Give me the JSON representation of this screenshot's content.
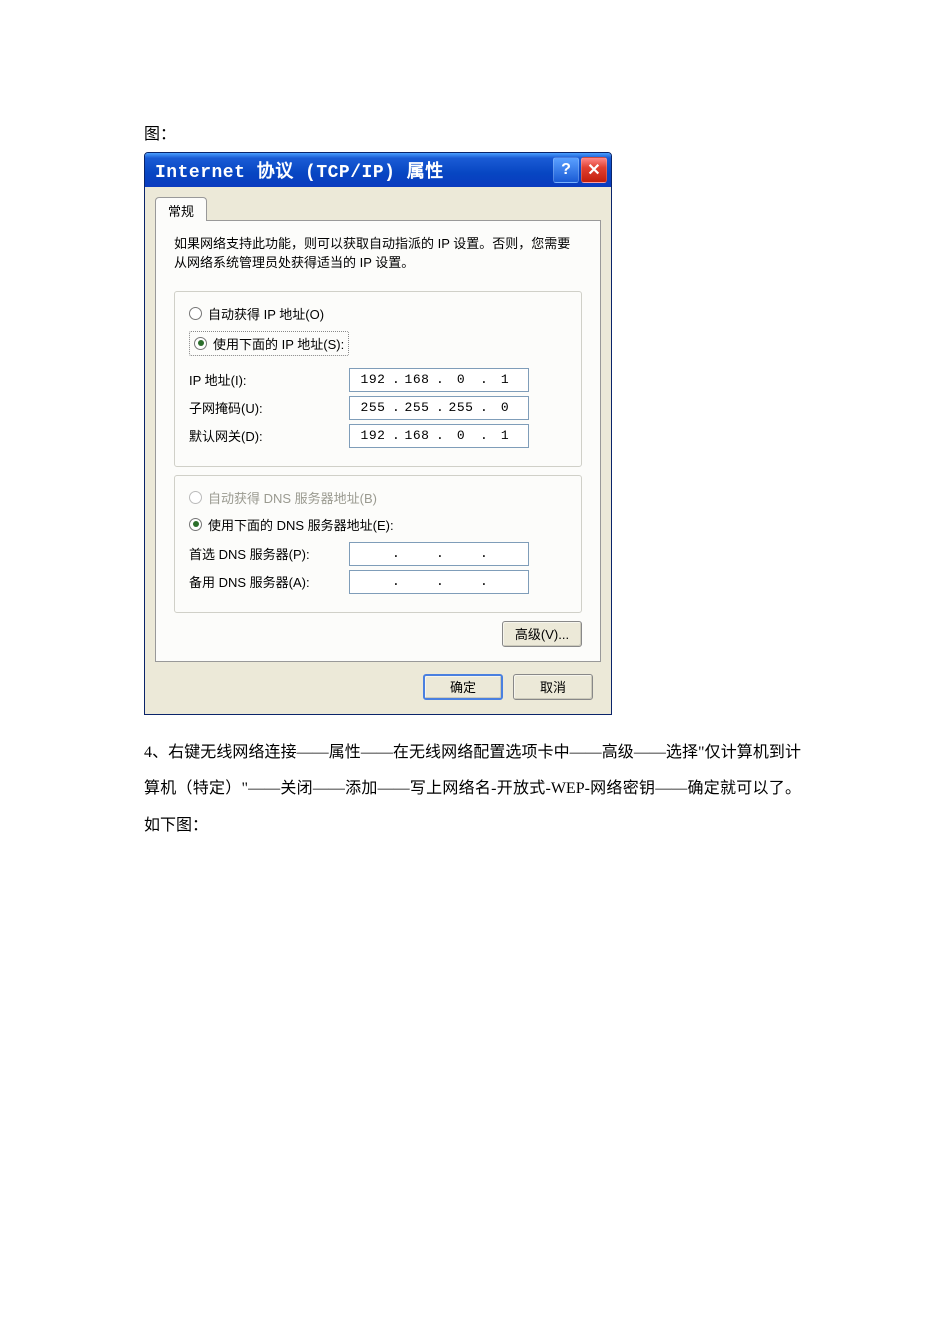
{
  "doc": {
    "intro": "图：",
    "para4": "4、右键无线网络连接——属性——在无线网络配置选项卡中——高级——选择\"仅计算机到计算机（特定）\"——关闭——添加——写上网络名-开放式-WEP-网络密钥——确定就可以了。如下图："
  },
  "dialog": {
    "title": "Internet 协议 (TCP/IP) 属性",
    "helpGlyph": "?",
    "closeGlyph": "✕",
    "tab": "常规",
    "description": "如果网络支持此功能，则可以获取自动指派的 IP 设置。否则，您需要从网络系统管理员处获得适当的 IP 设置。",
    "ip": {
      "radioAuto": "自动获得 IP 地址(O)",
      "radioManual": "使用下面的 IP 地址(S):",
      "fields": {
        "ipLabel": "IP 地址(I):",
        "ipValue": [
          "192",
          "168",
          "0",
          "1"
        ],
        "maskLabel": "子网掩码(U):",
        "maskValue": [
          "255",
          "255",
          "255",
          "0"
        ],
        "gwLabel": "默认网关(D):",
        "gwValue": [
          "192",
          "168",
          "0",
          "1"
        ]
      }
    },
    "dns": {
      "radioAuto": "自动获得 DNS 服务器地址(B)",
      "radioManual": "使用下面的 DNS 服务器地址(E):",
      "fields": {
        "primaryLabel": "首选 DNS 服务器(P):",
        "primaryValue": [
          "",
          "",
          "",
          ""
        ],
        "altLabel": "备用 DNS 服务器(A):",
        "altValue": [
          "",
          "",
          "",
          ""
        ]
      }
    },
    "advanced": "高级(V)...",
    "ok": "确定",
    "cancel": "取消"
  }
}
